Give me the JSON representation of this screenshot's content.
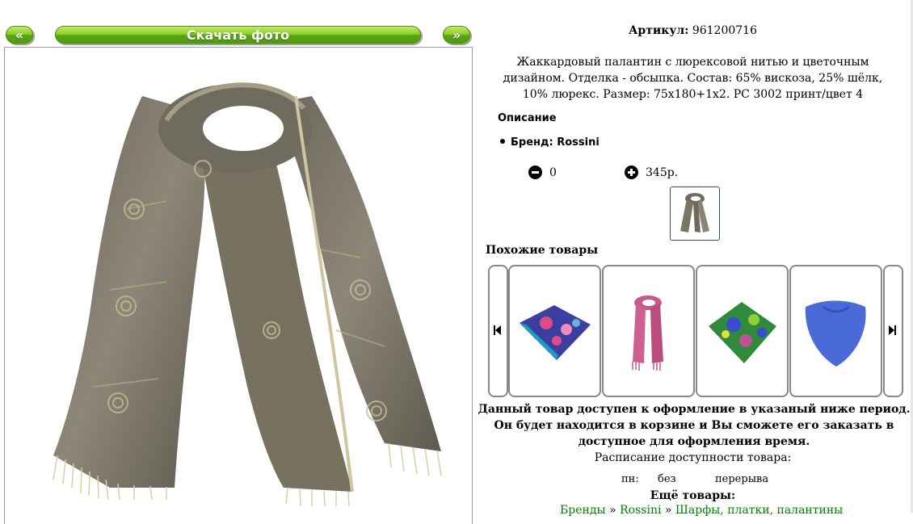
{
  "nav": {
    "prev_label": "«",
    "download_label": "Скачать фото",
    "next_label": "»"
  },
  "product": {
    "article_label": "Артикул:",
    "article_value": "961200716",
    "description": "Жаккардовый палантин с люрексовой нитью и цветочным дизайном. Отделка - обсыпка. Состав: 65% вискоза, 25% шёлк, 10% люрекс. Размер: 75x180+1x2. PC 3002 принт/цвет 4",
    "description_title": "Описание",
    "brand": "Бренд: Rossini",
    "quantity": "0",
    "price": "345р."
  },
  "similar": {
    "title": "Похожие товары",
    "items": [
      {
        "name": "platok-blue-floral",
        "color": "#3a3fa0"
      },
      {
        "name": "scarf-pink",
        "color": "#c8578a"
      },
      {
        "name": "platok-green-floral",
        "color": "#2f8a3c"
      },
      {
        "name": "scarf-blue",
        "color": "#4a6ad8"
      }
    ]
  },
  "availability": {
    "notice": "Данный товар доступен к оформление в указаный ниже период. Он будет находится в корзине и Вы сможете его заказать в доступное для оформления время.",
    "schedule_title": "Расписание доступности товара:",
    "day": "пн:",
    "from": "без",
    "to": "перерыва"
  },
  "more": {
    "title": "Ещё товары:",
    "crumbs": [
      "Бренды",
      "Rossini",
      "Шарфы, платки, палантины"
    ],
    "separator": "»"
  },
  "icons": {
    "prev": "chevron-double-left-icon",
    "next": "chevron-double-right-icon",
    "minus": "minus-circle-icon",
    "plus": "plus-circle-icon",
    "car_prev": "skip-back-icon",
    "car_next": "skip-forward-icon"
  }
}
